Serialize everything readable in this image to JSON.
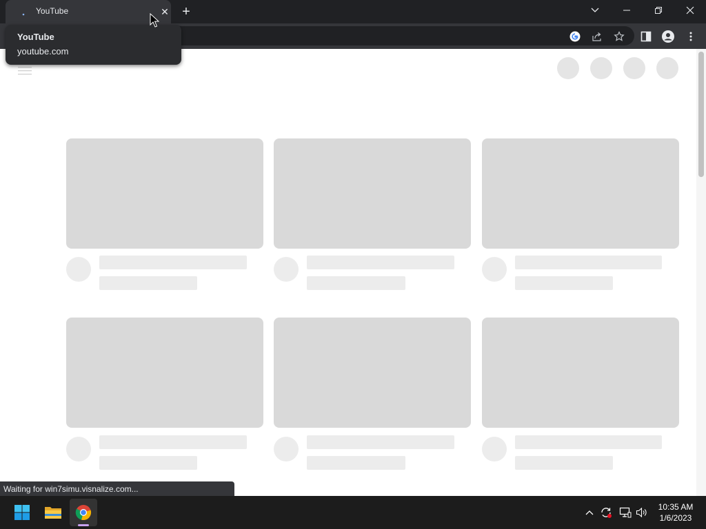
{
  "browser": {
    "tab": {
      "title": "YouTube"
    },
    "tooltip": {
      "title": "YouTube",
      "url": "youtube.com"
    },
    "status_text": "Waiting for win7simu.visnalize.com...",
    "toolbar_icons": [
      "google-icon",
      "share-icon",
      "bookmark-star-icon",
      "side-panel-icon",
      "profile-icon",
      "kebab-menu-icon"
    ],
    "window_controls": [
      "tab-search-icon",
      "minimize-icon",
      "restore-icon",
      "close-window-icon"
    ]
  },
  "page": {
    "state": "loading-skeleton",
    "header_placeholders": 4,
    "video_card_placeholders": 6
  },
  "taskbar": {
    "apps": [
      "windows-start-icon",
      "file-explorer-icon",
      "chrome-icon"
    ],
    "tray_icons": [
      "chevron-up-icon",
      "sync-icon",
      "network-icon",
      "volume-icon"
    ],
    "clock": {
      "time": "10:35 AM",
      "date": "1/6/2023"
    }
  },
  "colors": {
    "browser_frame": "#202124",
    "toolbar": "#35363a",
    "skeleton_thumb": "#d9d9d9",
    "skeleton_line": "#ececec",
    "taskbar": "#1c1c1c"
  }
}
